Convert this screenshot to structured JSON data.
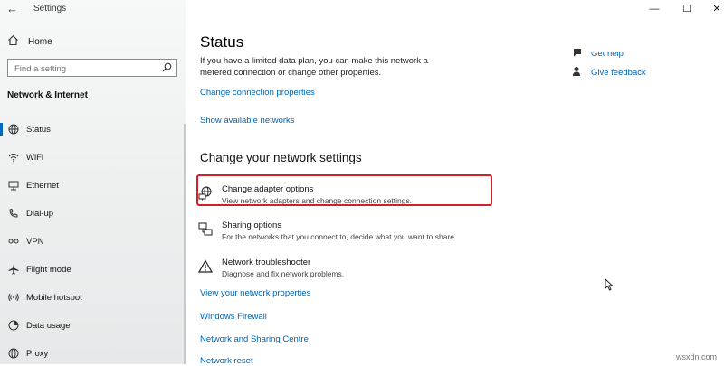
{
  "window": {
    "title": "Settings",
    "minimize": "—",
    "maximize": "☐",
    "close": "✕"
  },
  "sidebar": {
    "back": "←",
    "home": "Home",
    "search_placeholder": "Find a setting",
    "section": "Network & Internet",
    "items": [
      {
        "label": "Status"
      },
      {
        "label": "WiFi"
      },
      {
        "label": "Ethernet"
      },
      {
        "label": "Dial-up"
      },
      {
        "label": "VPN"
      },
      {
        "label": "Flight mode"
      },
      {
        "label": "Mobile hotspot"
      },
      {
        "label": "Data usage"
      },
      {
        "label": "Proxy"
      }
    ]
  },
  "main": {
    "title": "Status",
    "description": "If you have a limited data plan, you can make this network a metered connection or change other properties.",
    "change_connection": "Change connection properties",
    "show_networks": "Show available networks",
    "section": "Change your network settings",
    "options": [
      {
        "title": "Change adapter options",
        "desc": "View network adapters and change connection settings."
      },
      {
        "title": "Sharing options",
        "desc": "For the networks that you connect to, decide what you want to share."
      },
      {
        "title": "Network troubleshooter",
        "desc": "Diagnose and fix network problems."
      }
    ],
    "links": {
      "properties": "View your network properties",
      "firewall": "Windows Firewall",
      "sharing_centre": "Network and Sharing Centre",
      "reset": "Network reset"
    }
  },
  "right": {
    "get_help": "Get help",
    "give_feedback": "Give feedback"
  },
  "watermark": "wsxdn.com",
  "colors": {
    "accent": "#0063b1",
    "highlight": "#d0202a"
  }
}
